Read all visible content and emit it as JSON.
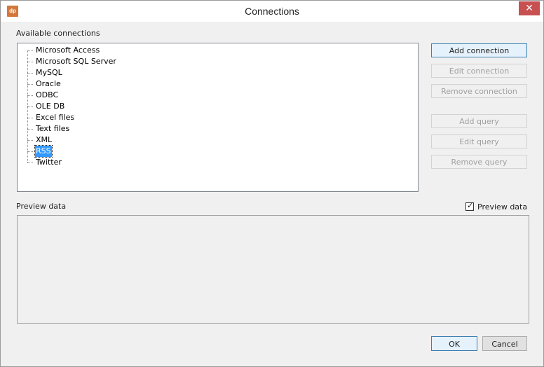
{
  "window": {
    "title": "Connections",
    "app_icon_text": "dp",
    "close_glyph": "✕"
  },
  "labels": {
    "available_connections": "Available connections",
    "preview_data": "Preview data"
  },
  "tree": {
    "items": [
      {
        "label": "Microsoft Access",
        "selected": false
      },
      {
        "label": "Microsoft SQL Server",
        "selected": false
      },
      {
        "label": "MySQL",
        "selected": false
      },
      {
        "label": "Oracle",
        "selected": false
      },
      {
        "label": "ODBC",
        "selected": false
      },
      {
        "label": "OLE DB",
        "selected": false
      },
      {
        "label": "Excel files",
        "selected": false
      },
      {
        "label": "Text files",
        "selected": false
      },
      {
        "label": "XML",
        "selected": false
      },
      {
        "label": "RSS",
        "selected": true
      },
      {
        "label": "Twitter",
        "selected": false
      }
    ]
  },
  "buttons": {
    "add_connection": "Add connection",
    "edit_connection": "Edit connection",
    "remove_connection": "Remove connection",
    "add_query": "Add query",
    "edit_query": "Edit query",
    "remove_query": "Remove query",
    "ok": "OK",
    "cancel": "Cancel"
  },
  "preview": {
    "checkbox_label": "Preview data",
    "checked": true,
    "check_glyph": "✓"
  }
}
